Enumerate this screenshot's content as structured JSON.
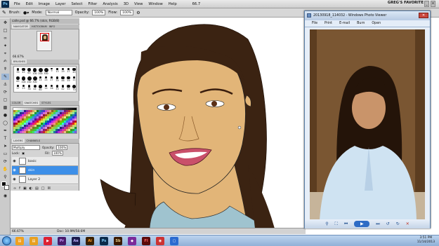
{
  "app": {
    "badge": "Ps"
  },
  "menu": [
    "File",
    "Edit",
    "Image",
    "Layer",
    "Select",
    "Filter",
    "Analysis",
    "3D",
    "View",
    "Window",
    "Help"
  ],
  "zoom_menu": "66.7",
  "favorite": "GREG'S FAVORITE",
  "options": {
    "brush_label": "Brush:",
    "mode_label": "Mode:",
    "mode_value": "Normal",
    "opacity_label": "Opacity:",
    "opacity_value": "100%",
    "flow_label": "Flow:",
    "flow_value": "100%"
  },
  "document": {
    "tab": "calle.psd @ 66.7% (skin, RGB/8)",
    "zoom": "66.67%",
    "doc_size": "Doc: 10.9M/58.6M"
  },
  "navigator": {
    "tabs": [
      "NAVIGATOR",
      "HISTOGRAM",
      "INFO"
    ],
    "zoom": "66.67%"
  },
  "brushes": {
    "tab": "BRUSHES",
    "sizes": [
      "35",
      "45",
      "65",
      "100",
      "200",
      "300",
      "9",
      "13",
      "19",
      "17",
      "45",
      "65",
      "100",
      "200",
      "300",
      "14",
      "24",
      "27",
      "39",
      "46",
      "59",
      "11",
      "17",
      "23",
      "36",
      "44",
      "60",
      "14",
      "26",
      "33",
      "42",
      "55",
      "70"
    ]
  },
  "color": {
    "tabs": [
      "COLOR",
      "SWATCHES",
      "STYLES"
    ]
  },
  "layers": {
    "tabs": [
      "LAYERS",
      "CHANNELS"
    ],
    "blend": "Multiply",
    "opacity_label": "Opacity:",
    "opacity": "100%",
    "lock_label": "Lock:",
    "fill_label": "Fill:",
    "fill": "100%",
    "items": [
      {
        "name": "basic"
      },
      {
        "name": "skin"
      },
      {
        "name": "Layer 2"
      }
    ]
  },
  "viewer": {
    "title": "20130918_114032 - Windows Photo Viewer",
    "menu": [
      "File",
      "Print",
      "E-mail",
      "Burn",
      "Open"
    ]
  },
  "clock": {
    "time": "3:51 PM",
    "date": "11/14/2013"
  },
  "taskbar": [
    "Pr",
    "Ae",
    "Ai",
    "Ps",
    "Sb",
    "Fl"
  ],
  "colors": {
    "accent": "#3d8fe8",
    "skin": "#e2b578",
    "hair": "#3b2312"
  }
}
